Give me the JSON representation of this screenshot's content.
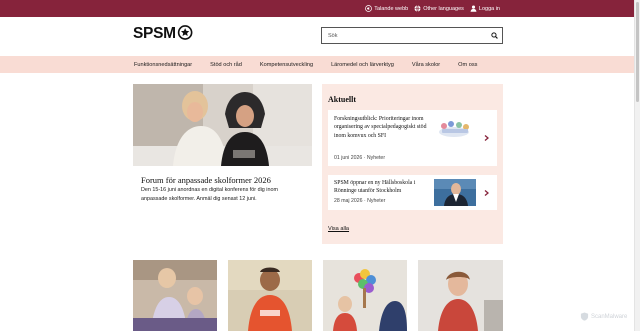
{
  "topbar": {
    "links": [
      {
        "label": "Talande webb",
        "icon": "speaker-icon"
      },
      {
        "label": "Other languages",
        "icon": "globe-icon"
      },
      {
        "label": "Logga in",
        "icon": "user-icon"
      }
    ]
  },
  "brand": {
    "logo_text": "SPSM"
  },
  "search": {
    "placeholder": "Sök"
  },
  "nav": {
    "items": [
      "Funktionsnedsättningar",
      "Stöd och råd",
      "Kompetensutveckling",
      "Läromedel och lärverktyg",
      "Våra skolor",
      "Om oss"
    ]
  },
  "hero": {
    "title": "Forum för anpassade skolformer 2026",
    "text": "Den 15-16 juni anordnas en digital konferens för dig inom anpassade skolformer. Anmäl dig senast 12 juni."
  },
  "aktuellt": {
    "title": "Aktuellt",
    "news": [
      {
        "title": "Forskningsutblick: Prioriteringar inom organisering av specialpedagogiskt stöd inom komvux och SFI",
        "meta": "01 juni 2026 · Nyheter"
      },
      {
        "title": "SPSM öppnar en ny Hällsboskola i Rönninge utanför Stockholm",
        "meta": "28 maj 2026 · Nyheter"
      }
    ],
    "view_all": "Visa alla"
  },
  "watermark": {
    "text": "ScanMalware"
  },
  "colors": {
    "topbar": "#86233b",
    "nav": "#f9dcd4",
    "aktuellt": "#fbe9e3",
    "chevron": "#86233b"
  }
}
